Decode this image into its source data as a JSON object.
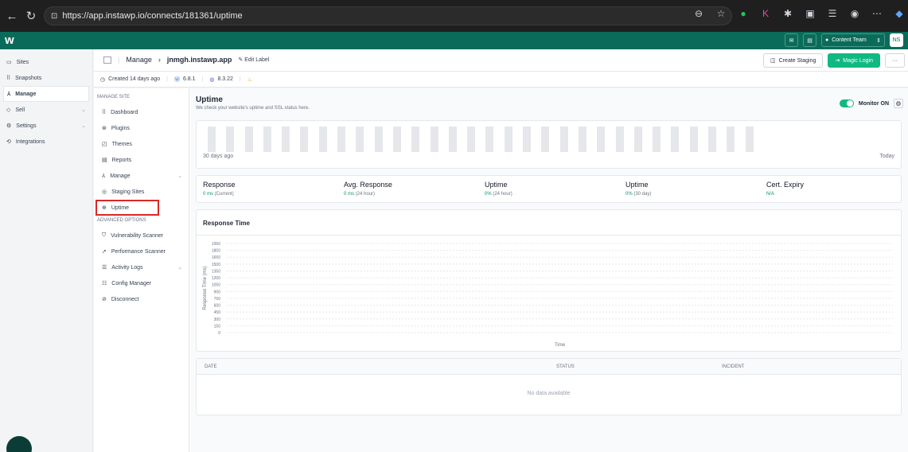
{
  "browser": {
    "url": "https://app.instawp.io/connects/181361/uptime",
    "icons": [
      "zoom-icon",
      "star-icon",
      "grammarly-icon",
      "extension-k-icon",
      "puzzle-icon",
      "split-icon",
      "favorites-icon",
      "profile-icon",
      "more-icon",
      "copilot-icon"
    ]
  },
  "header": {
    "logo": "w",
    "team_label": "Content Team",
    "avatar": "NS"
  },
  "sidebar": {
    "items": [
      {
        "label": "Sites",
        "icon": "sites-icon"
      },
      {
        "label": "Snapshots",
        "icon": "snapshots-icon"
      },
      {
        "label": "Manage",
        "icon": "manage-icon"
      },
      {
        "label": "Sell",
        "icon": "sell-icon"
      },
      {
        "label": "Settings",
        "icon": "settings-icon"
      },
      {
        "label": "Integrations",
        "icon": "integrations-icon"
      }
    ]
  },
  "breadcrumb": {
    "section": "Manage",
    "site": "jnmgh.instawp.app",
    "edit_label": "Edit Label"
  },
  "actions": {
    "create_staging": "Create Staging",
    "magic_login": "Magic Login",
    "more": "···"
  },
  "meta": {
    "created": "Created 14 days ago",
    "wp_version": "6.8.1",
    "php_version": "8.3.22"
  },
  "subnav": {
    "heading": "MANAGE SITE",
    "items": [
      {
        "label": "Dashboard"
      },
      {
        "label": "Plugins"
      },
      {
        "label": "Themes"
      },
      {
        "label": "Reports"
      },
      {
        "label": "Manage"
      },
      {
        "label": "Staging Sites"
      },
      {
        "label": "Uptime"
      }
    ],
    "advanced_heading": "ADVANCED OPTIONS",
    "advanced_items": [
      {
        "label": "Vulnerability Scanner"
      },
      {
        "label": "Performance Scanner"
      },
      {
        "label": "Activity Logs"
      },
      {
        "label": "Config Manager"
      },
      {
        "label": "Disconnect"
      }
    ]
  },
  "uptime": {
    "title": "Uptime",
    "subtitle": "We check your website's uptime and SSL status here.",
    "monitor_label": "Monitor ON",
    "monitor_on": true,
    "bars_count": 30,
    "left_label": "30 days ago",
    "right_label": "Today"
  },
  "stats": [
    {
      "title": "Response",
      "value": "0 ms",
      "sub": "(Current)"
    },
    {
      "title": "Avg. Response",
      "value": "0 ms",
      "sub": "(24 hour)"
    },
    {
      "title": "Uptime",
      "value": "0%",
      "sub": "(24 hour)"
    },
    {
      "title": "Uptime",
      "value": "0%",
      "sub": "(30 day)"
    },
    {
      "title": "Cert. Expiry",
      "value": "N/A",
      "sub": ""
    }
  ],
  "chart_data": {
    "type": "line",
    "title": "Response Time",
    "xlabel": "Time",
    "ylabel": "Response Time (ms)",
    "yticks": [
      0,
      150,
      300,
      450,
      600,
      750,
      900,
      1050,
      1200,
      1350,
      1500,
      1650,
      1800,
      1950
    ],
    "ylim": [
      0,
      1950
    ],
    "series": [],
    "grid": true
  },
  "table": {
    "columns": [
      "DATE",
      "STATUS",
      "INCIDENT"
    ],
    "empty_text": "No data available"
  }
}
